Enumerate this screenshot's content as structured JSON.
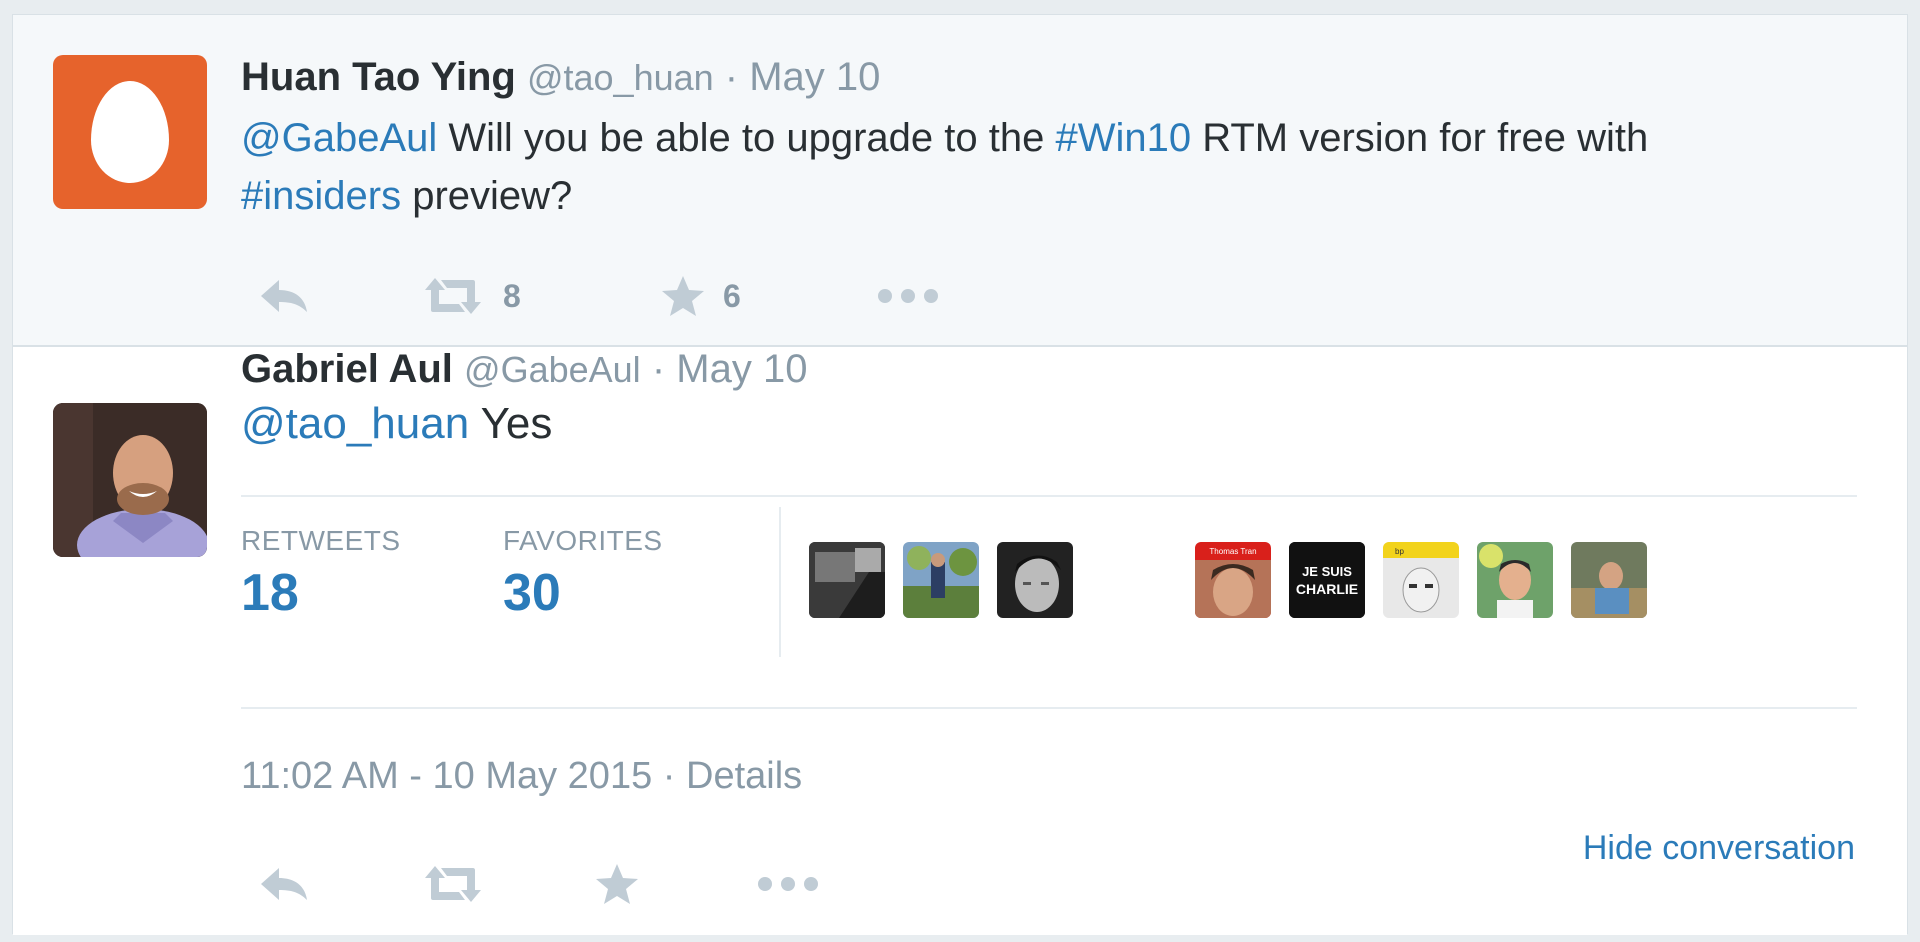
{
  "parent_tweet": {
    "name": "Huan Tao Ying",
    "handle": "@tao_huan",
    "separator": "·",
    "date": "May 10",
    "text_parts": {
      "mention": "@GabeAul",
      "t1": " Will you be able to upgrade to the ",
      "hashtag1": "#Win10",
      "t2": " RTM version for free with",
      "hashtag2": "#insiders",
      "t3": " preview?"
    },
    "retweet_count": "8",
    "favorite_count": "6",
    "avatar_icon": "egg-icon"
  },
  "main_tweet": {
    "name": "Gabriel Aul",
    "handle": "@GabeAul",
    "separator": "·",
    "date": "May 10",
    "mention": "@tao_huan",
    "text": " Yes",
    "stats": {
      "retweets_label": "RETWEETS",
      "retweets_value": "18",
      "favorites_label": "FAVORITES",
      "favorites_value": "30"
    },
    "favoriters": [
      {
        "label": ""
      },
      {
        "label": ""
      },
      {
        "label": ""
      },
      {
        "label": "Thomas Tran"
      },
      {
        "label": "JE SUIS CHARLIE"
      },
      {
        "label": "bp"
      },
      {
        "label": ""
      },
      {
        "label": ""
      }
    ],
    "timestamp": "11:02 AM - 10 May 2015",
    "details_sep": " · ",
    "details_link": "Details",
    "hide_conversation": "Hide conversation"
  },
  "colors": {
    "link": "#2b7bb9",
    "muted": "#8899a6",
    "text": "#292f33",
    "egg_bg": "#e6632c",
    "parent_bg": "#f5f8fa"
  },
  "icons": [
    "reply-icon",
    "retweet-icon",
    "favorite-star-icon",
    "more-dots-icon"
  ]
}
